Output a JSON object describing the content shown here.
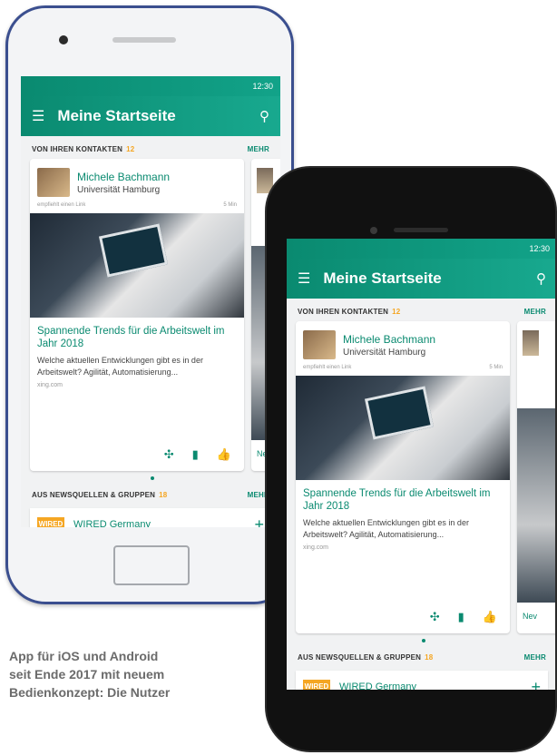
{
  "app": {
    "status_time": "12:30",
    "title": "Meine Startseite"
  },
  "contacts_section": {
    "label": "VON IHREN KONTAKTEN",
    "count": "12",
    "more": "MEHR"
  },
  "card": {
    "name": "Michele Bachmann",
    "org": "Universität Hamburg",
    "activity": "empfiehlt einen Link",
    "time": "5 Min",
    "headline": "Spannende Trends für die Arbeitswelt im Jahr 2018",
    "body": "Welche aktuellen Entwicklungen gibt es in der Arbeitswelt? Agilität, Automatisierung...",
    "source": "xing.com"
  },
  "peek_card": {
    "label": "Nev"
  },
  "news_section": {
    "label": "AUS NEWSQUELLEN & GRUPPEN",
    "count": "18",
    "more": "MEHR"
  },
  "news_item": {
    "logo": "WIRED",
    "name": "WIRED Germany"
  },
  "caption": {
    "line1": "App für iOS und Android",
    "line2": "seit Ende 2017 mit neuem",
    "line3": "Bedienkonzept: Die Nutzer"
  },
  "icons": [
    "menu-icon",
    "search-icon",
    "share-icon",
    "comment-icon",
    "like-icon",
    "add-icon"
  ]
}
